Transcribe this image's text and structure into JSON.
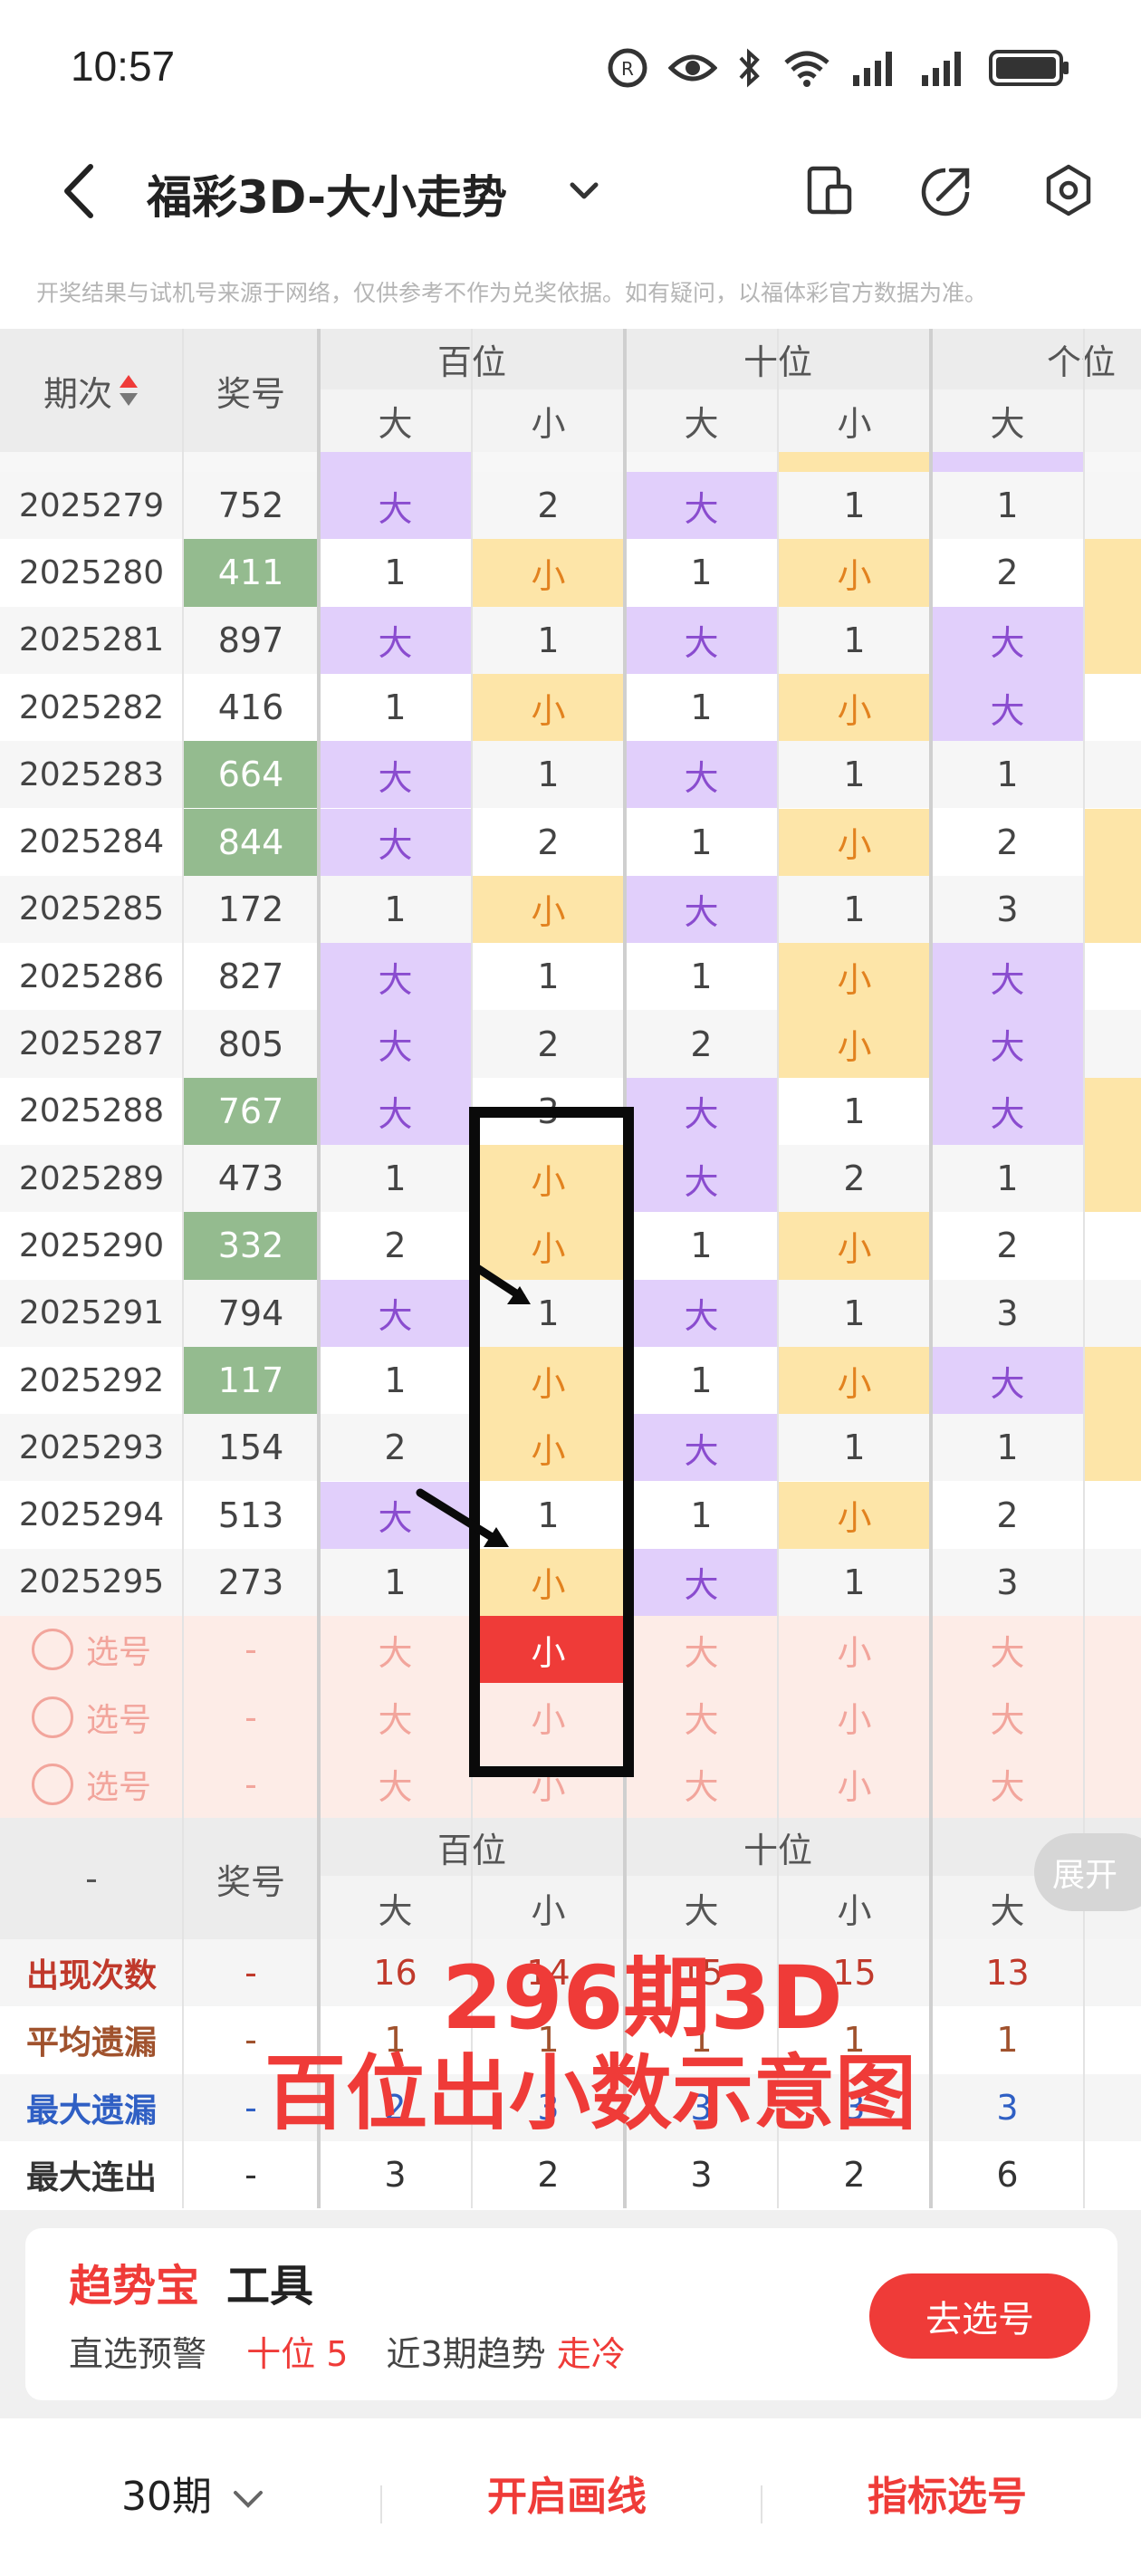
{
  "status": {
    "time": "10:57"
  },
  "nav": {
    "title": "福彩3D-大小走势"
  },
  "disclaimer": "开奖结果与试机号来源于网络，仅供参考不作为兑奖依据。如有疑问，以福体彩官方数据为准。",
  "table": {
    "header": {
      "period": "期次",
      "number": "奖号",
      "positions": [
        "百位",
        "十位",
        "个位"
      ],
      "big": "大",
      "small": "小"
    },
    "rows": [
      {
        "period": "2025279",
        "number": "752",
        "hl": false,
        "cells": [
          "大",
          "2",
          "大",
          "1",
          "1"
        ]
      },
      {
        "period": "2025280",
        "number": "411",
        "hl": true,
        "cells": [
          "1",
          "小",
          "1",
          "小",
          "2"
        ]
      },
      {
        "period": "2025281",
        "number": "897",
        "hl": false,
        "cells": [
          "大",
          "1",
          "大",
          "1",
          "大"
        ]
      },
      {
        "period": "2025282",
        "number": "416",
        "hl": false,
        "cells": [
          "1",
          "小",
          "1",
          "小",
          "大"
        ]
      },
      {
        "period": "2025283",
        "number": "664",
        "hl": true,
        "cells": [
          "大",
          "1",
          "大",
          "1",
          "1"
        ]
      },
      {
        "period": "2025284",
        "number": "844",
        "hl": true,
        "cells": [
          "大",
          "2",
          "1",
          "小",
          "2"
        ]
      },
      {
        "period": "2025285",
        "number": "172",
        "hl": false,
        "cells": [
          "1",
          "小",
          "大",
          "1",
          "3"
        ]
      },
      {
        "period": "2025286",
        "number": "827",
        "hl": false,
        "cells": [
          "大",
          "1",
          "1",
          "小",
          "大"
        ]
      },
      {
        "period": "2025287",
        "number": "805",
        "hl": false,
        "cells": [
          "大",
          "2",
          "2",
          "小",
          "大"
        ]
      },
      {
        "period": "2025288",
        "number": "767",
        "hl": true,
        "cells": [
          "大",
          "3",
          "大",
          "1",
          "大"
        ]
      },
      {
        "period": "2025289",
        "number": "473",
        "hl": false,
        "cells": [
          "1",
          "小",
          "大",
          "2",
          "1"
        ]
      },
      {
        "period": "2025290",
        "number": "332",
        "hl": true,
        "cells": [
          "2",
          "小",
          "1",
          "小",
          "2"
        ]
      },
      {
        "period": "2025291",
        "number": "794",
        "hl": false,
        "cells": [
          "大",
          "1",
          "大",
          "1",
          "3"
        ]
      },
      {
        "period": "2025292",
        "number": "117",
        "hl": true,
        "cells": [
          "1",
          "小",
          "1",
          "小",
          "大"
        ]
      },
      {
        "period": "2025293",
        "number": "154",
        "hl": false,
        "cells": [
          "2",
          "小",
          "大",
          "1",
          "1"
        ]
      },
      {
        "period": "2025294",
        "number": "513",
        "hl": false,
        "cells": [
          "大",
          "1",
          "1",
          "小",
          "2"
        ]
      },
      {
        "period": "2025295",
        "number": "273",
        "hl": false,
        "cells": [
          "1",
          "小",
          "大",
          "1",
          "3"
        ]
      }
    ],
    "pick_rows": [
      {
        "label": "选号",
        "number": "-"
      },
      {
        "label": "选号",
        "number": "-"
      },
      {
        "label": "选号",
        "number": "-"
      }
    ],
    "summary_header": {
      "dash": "-",
      "number": "奖号"
    },
    "summary": [
      {
        "label": "出现次数",
        "dash": "-",
        "values": [
          "16",
          "14",
          "15",
          "15",
          "13"
        ],
        "color": "#c0392b"
      },
      {
        "label": "平均遗漏",
        "dash": "-",
        "values": [
          "1",
          "1",
          "1",
          "1",
          "1"
        ],
        "color": "#a0522d"
      },
      {
        "label": "最大遗漏",
        "dash": "-",
        "values": [
          "2",
          "3",
          "3",
          "3",
          "3"
        ],
        "color": "#2f5fc4"
      },
      {
        "label": "最大连出",
        "dash": "-",
        "values": [
          "3",
          "2",
          "3",
          "2",
          "6"
        ],
        "color": "#333333"
      }
    ],
    "expand": "展开"
  },
  "annotation": {
    "line1": "296期3D",
    "line2": "百位出小数示意图"
  },
  "tool": {
    "brand": "趋势宝",
    "name": "工具",
    "warn_label": "直选预警",
    "warn_value": "十位 5",
    "trend_label": "近3期趋势",
    "trend_value": "走冷",
    "button": "去选号"
  },
  "bottom": {
    "periods": "30期",
    "draw": "开启画线",
    "indicator": "指标选号"
  },
  "colors": {
    "big": "#e1cffb",
    "small": "#fde5a8",
    "hl": "#94bb8f",
    "selected": "#ef3b38",
    "pick_bg": "#fdece7"
  }
}
